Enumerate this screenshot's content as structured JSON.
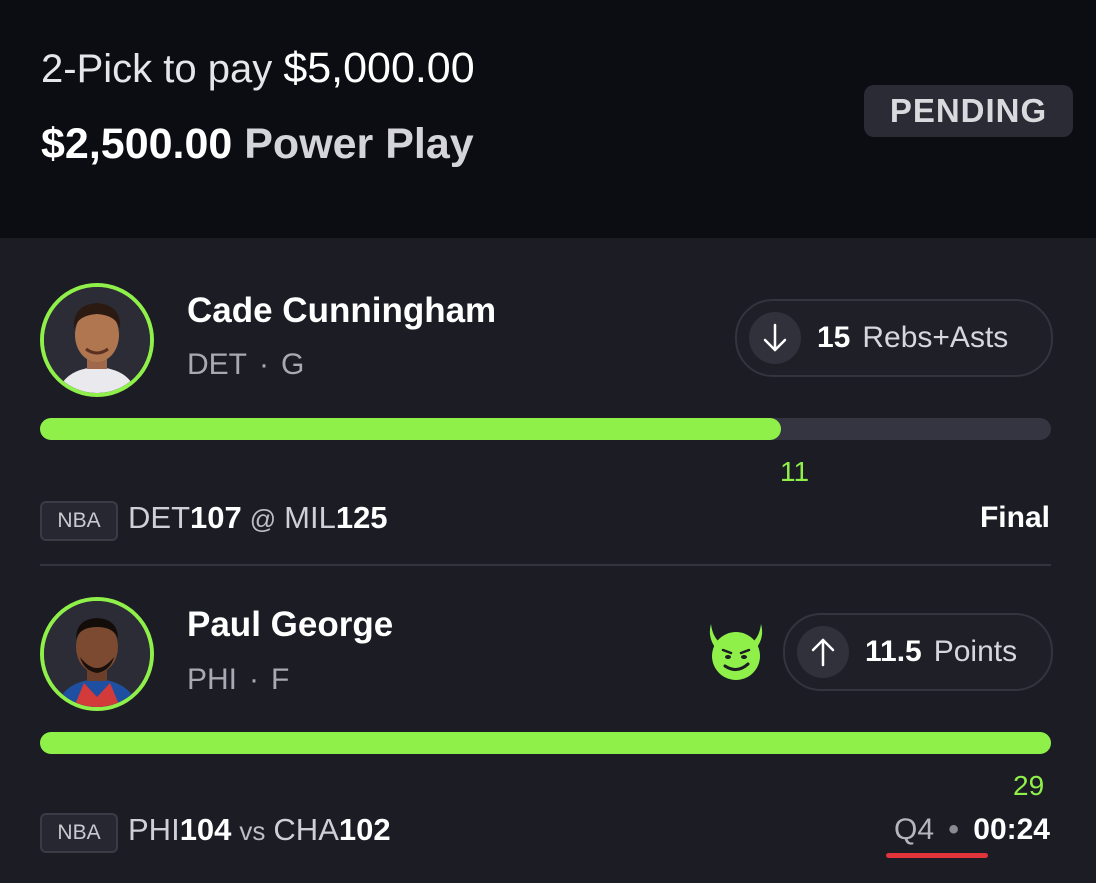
{
  "header": {
    "pick_text": "2-Pick to pay",
    "payout": "$5,000.00",
    "entry_amount": "$2,500.00",
    "entry_type": "Power Play",
    "status": "PENDING"
  },
  "picks": [
    {
      "player_name": "Cade Cunningham",
      "team": "DET",
      "position": "G",
      "direction": "less",
      "direction_icon": "arrow-down-icon",
      "line_value": "15",
      "stat_type": "Rebs+Asts",
      "current_value": "11",
      "progress_fraction": 0.733,
      "league": "NBA",
      "game": {
        "away_team": "DET",
        "away_score": "107",
        "connector": "@",
        "home_team": "MIL",
        "home_score": "125"
      },
      "game_status": "Final"
    },
    {
      "player_name": "Paul George",
      "team": "PHI",
      "position": "F",
      "direction": "more",
      "direction_icon": "arrow-up-icon",
      "badge_icon": "smiling-devil-icon",
      "line_value": "11.5",
      "stat_type": "Points",
      "current_value": "29",
      "progress_fraction": 1.0,
      "league": "NBA",
      "game": {
        "home_team": "PHI",
        "home_score": "104",
        "connector": "vs",
        "away_team": "CHA",
        "away_score": "102"
      },
      "game_period": "Q4",
      "game_clock": "00:24"
    }
  ],
  "colors": {
    "accent_green": "#8ff04a",
    "live_red": "#e0343a",
    "background": "#1b1c24",
    "header_background": "#0c0d13"
  }
}
